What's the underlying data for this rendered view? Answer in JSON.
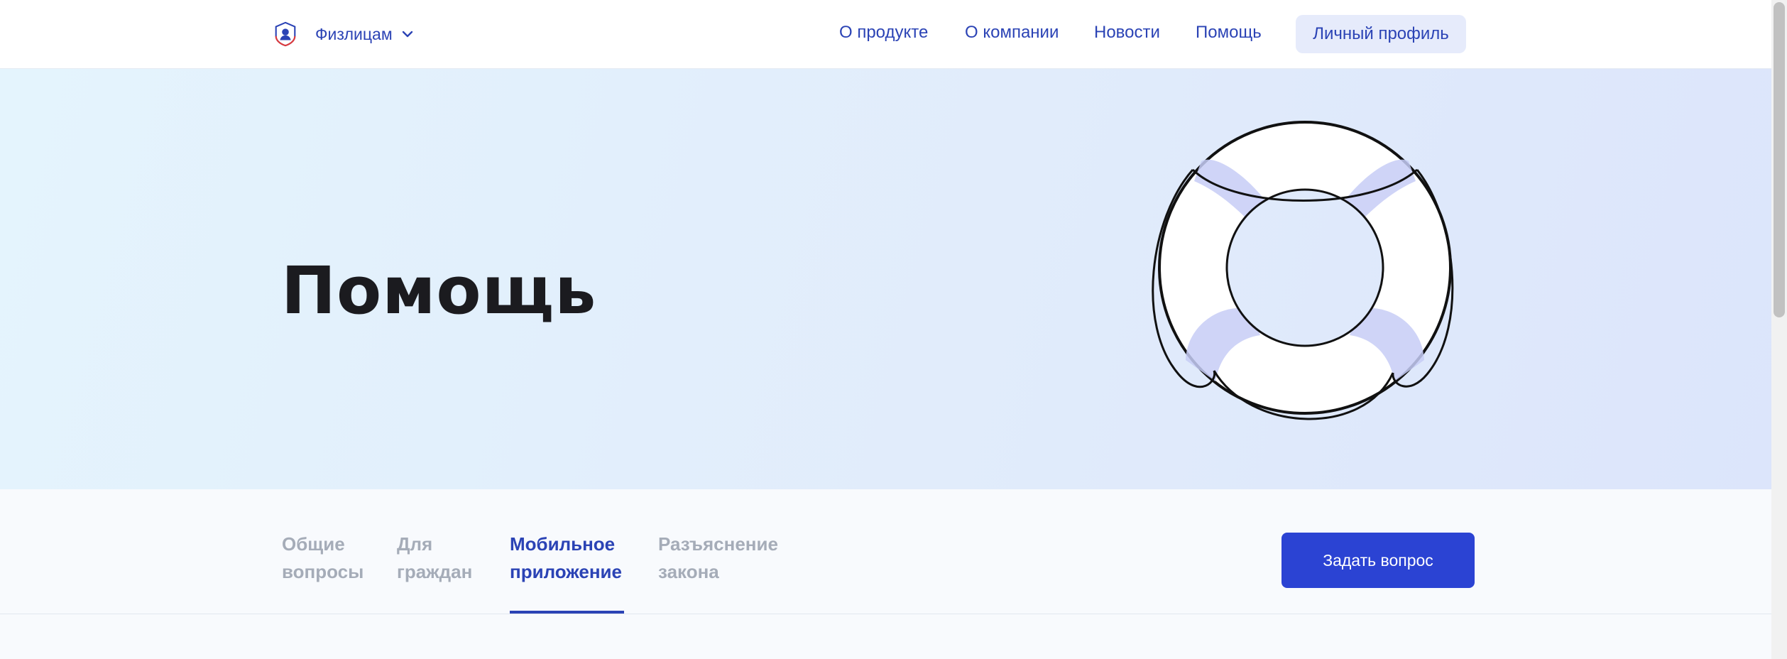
{
  "header": {
    "brand_label": "Физлицам",
    "logo_icon": "shield-person-logo-icon",
    "chevron_icon": "chevron-down-icon",
    "nav": [
      {
        "label": "О продукте"
      },
      {
        "label": "О компании"
      },
      {
        "label": "Новости"
      },
      {
        "label": "Помощь"
      }
    ],
    "profile_label": "Личный профиль"
  },
  "hero": {
    "title": "Помощь",
    "illustration_icon": "lifebuoy-icon"
  },
  "tabs": [
    {
      "label": "Общие\nвопросы",
      "active": false
    },
    {
      "label": "Для\nграждан",
      "active": false
    },
    {
      "label": "Мобильное\nприложение",
      "active": true
    },
    {
      "label": "Разъяснение\nзакона",
      "active": false
    }
  ],
  "ask_button_label": "Задать вопрос",
  "colors": {
    "accent": "#2b43b5",
    "button_primary": "#2b43d3",
    "profile_button_bg": "#e6ebfb",
    "tab_inactive": "#a5acb8",
    "title": "#1b1b1f"
  }
}
